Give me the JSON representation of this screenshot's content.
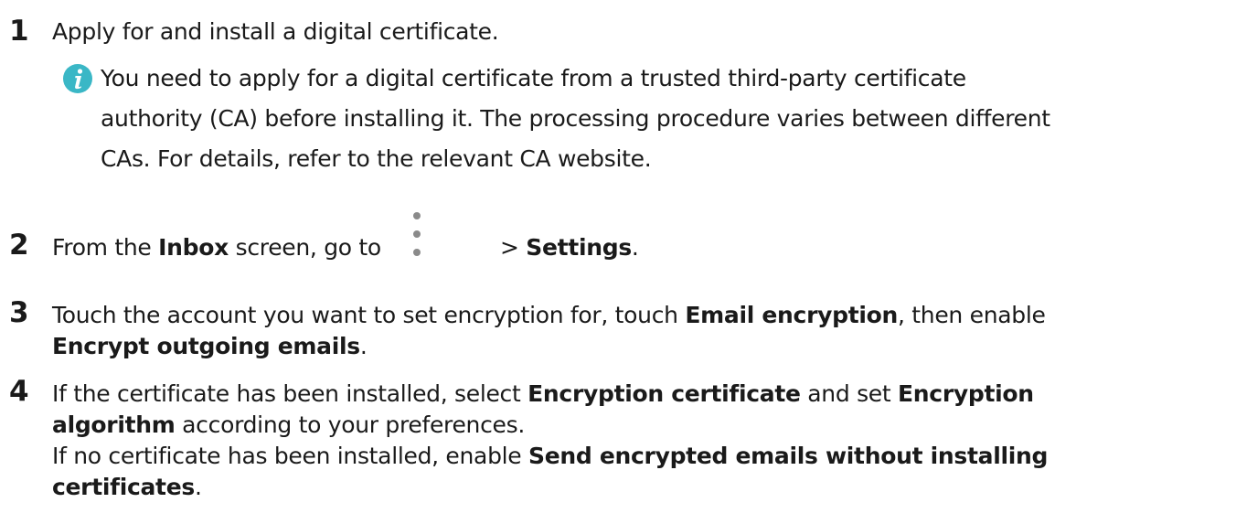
{
  "steps": [
    {
      "num": "1",
      "text": "Apply for and install a digital certificate.",
      "note": {
        "icon": "info-icon",
        "lines": [
          "You need to apply for a digital certificate from a trusted third-party certificate",
          "authority (CA) before installing it. The processing procedure varies between different",
          "CAs. For details, refer to the relevant CA website."
        ]
      }
    },
    {
      "num": "2",
      "parts": {
        "a": "From the ",
        "b_inbox": "Inbox",
        "c": " screen, go to",
        "icon": "more-vertical-icon",
        "d": " > ",
        "e_settings": "Settings",
        "f": "."
      }
    },
    {
      "num": "3",
      "parts": {
        "a": "Touch the account you want to set encryption for, touch ",
        "b": "Email encryption",
        "c": ", then enable",
        "d": "Encrypt outgoing emails",
        "e": "."
      }
    },
    {
      "num": "4",
      "parts": {
        "a": "If the certificate has been installed, select ",
        "b": "Encryption certificate",
        "c": " and set ",
        "d": "Encryption",
        "e": "algorithm",
        "f": " according to your preferences.",
        "g": "If no certificate has been installed, enable ",
        "h": "Send encrypted emails without installing",
        "i": "certificates",
        "j": "."
      }
    }
  ],
  "colors": {
    "text": "#1a1a1a",
    "info_icon_bg": "#3ab7c6",
    "more_icon_dots": "#8a8a8a"
  }
}
